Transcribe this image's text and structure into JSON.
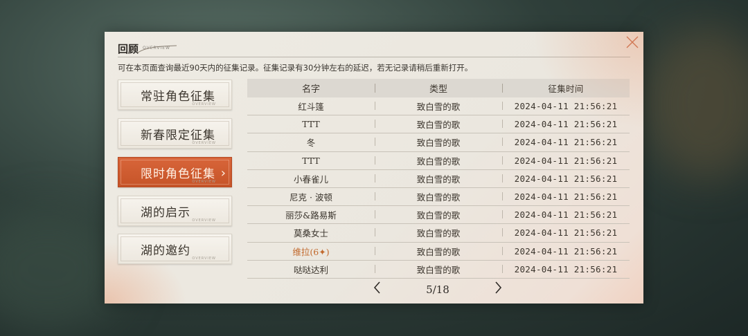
{
  "header": {
    "title": "回顾",
    "subtitle": "OVERVIEW",
    "description": "可在本页面查询最近90天内的征集记录。征集记录有30分钟左右的延迟，若无记录请稍后重新打开。"
  },
  "categories": [
    {
      "label": "常驻角色征集",
      "tag": "OVERVIEW",
      "active": false
    },
    {
      "label": "新春限定征集",
      "tag": "OVERVIEW",
      "active": false
    },
    {
      "label": "限时角色征集",
      "tag": "OVERVIEW",
      "active": true
    },
    {
      "label": "湖的启示",
      "tag": "OVERVIEW",
      "active": false
    },
    {
      "label": "湖的邀约",
      "tag": "OVERVIEW",
      "active": false
    }
  ],
  "table": {
    "headers": [
      "名字",
      "类型",
      "征集时间"
    ],
    "rows": [
      {
        "name": "红斗篷",
        "type": "致白雪的歌",
        "time": "2024-04-11 21:56:21",
        "highlight": false
      },
      {
        "name": "TTT",
        "type": "致白雪的歌",
        "time": "2024-04-11 21:56:21",
        "highlight": false
      },
      {
        "name": "冬",
        "type": "致白雪的歌",
        "time": "2024-04-11 21:56:21",
        "highlight": false
      },
      {
        "name": "TTT",
        "type": "致白雪的歌",
        "time": "2024-04-11 21:56:21",
        "highlight": false
      },
      {
        "name": "小春雀儿",
        "type": "致白雪的歌",
        "time": "2024-04-11 21:56:21",
        "highlight": false
      },
      {
        "name": "尼克 · 波顿",
        "type": "致白雪的歌",
        "time": "2024-04-11 21:56:21",
        "highlight": false
      },
      {
        "name": "丽莎&路易斯",
        "type": "致白雪的歌",
        "time": "2024-04-11 21:56:21",
        "highlight": false
      },
      {
        "name": "莫桑女士",
        "type": "致白雪的歌",
        "time": "2024-04-11 21:56:21",
        "highlight": false
      },
      {
        "name": "维拉(6✦)",
        "type": "致白雪的歌",
        "time": "2024-04-11 21:56:21",
        "highlight": true
      },
      {
        "name": "哒哒达利",
        "type": "致白雪的歌",
        "time": "2024-04-11 21:56:21",
        "highlight": false
      }
    ]
  },
  "pager": {
    "text": "5/18",
    "prev_icon": "chevron-left-icon",
    "next_icon": "chevron-right-icon"
  },
  "colors": {
    "accent": "#d05f33",
    "highlight_text": "#c26a2e"
  }
}
